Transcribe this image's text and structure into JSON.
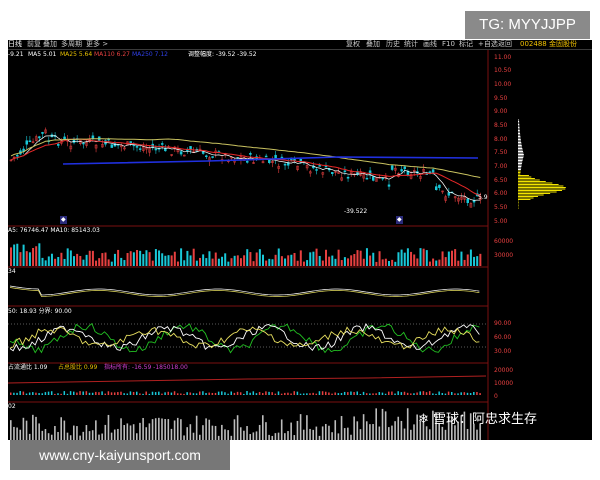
{
  "watermarks": {
    "tg": "TG: MYYJJPP",
    "url": "www.cny-kaiyunsport.com",
    "xueqiu": "雪球：阿忠求生存"
  },
  "toolbar": {
    "left_items": [
      "日线",
      "前复",
      "叠加",
      "多周期",
      "更多 >"
    ],
    "right_items": [
      "复权",
      "叠加",
      "历史",
      "统计",
      "画线",
      "F10",
      "标记",
      "+自选",
      "返回"
    ],
    "stock": "002488 金固股份"
  },
  "main_panel": {
    "ma_values": [
      "-9.21",
      "MA5 5.01",
      "MA25 5.64",
      "MA110 6.27",
      "MA250 7.12"
    ],
    "adjust_label": "调整幅度: -39.52 -39.52",
    "price_axis": [
      "11.00",
      "10.50",
      "10.00",
      "9.50",
      "9.00",
      "8.50",
      "8.00",
      "7.50",
      "7.00",
      "6.50",
      "6.00",
      "5.50",
      "5.00"
    ],
    "low_annotation": "-39.522",
    "last_price_tag": "5.9"
  },
  "volume_panel": {
    "label": "A5: 76746.47  MA10: 85143.03",
    "axis": [
      "60000",
      "30000"
    ]
  },
  "macd_panel": {
    "label": "34"
  },
  "kdj_panel": {
    "label": "50: 18.93  分界: 90.00",
    "axis": [
      "90.00",
      "60.00",
      "30.00"
    ]
  },
  "flow_panel": {
    "label_parts": [
      "占流通比 1.09",
      "占总股比 0.99",
      "指标所有: -16.59 -185018.00"
    ],
    "axis": [
      "20000",
      "10000",
      "0"
    ]
  },
  "bottom_panel": {
    "label": "02"
  },
  "colors": {
    "up": "#e84040",
    "down": "#19c8d8",
    "ma_white": "#ffffff",
    "ma_yellow": "#c9c260",
    "ma_red": "#e82828",
    "ma_blue": "#2030e0",
    "chip": "#f2e400",
    "kdj_green": "#22c022",
    "kdj_yellow": "#e8e060"
  }
}
